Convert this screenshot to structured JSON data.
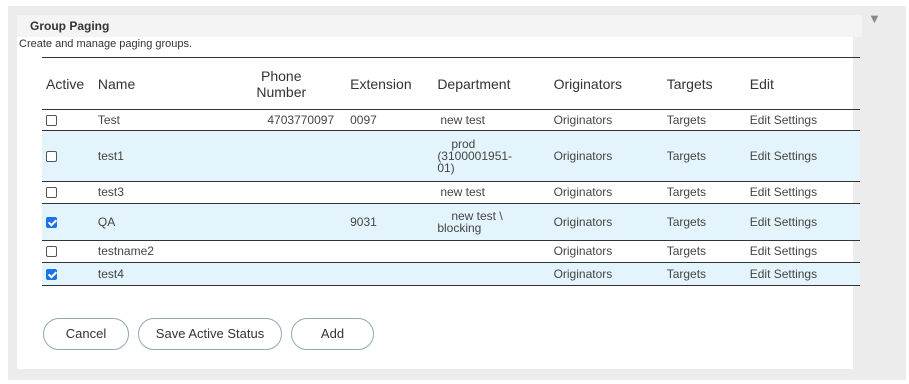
{
  "panel": {
    "title": "Group Paging",
    "subtitle": "Create and manage paging groups.",
    "collapse_glyph": "▼"
  },
  "table": {
    "headers": {
      "active": "Active",
      "name": "Name",
      "phone_line1": "Phone",
      "phone_line2": "Number",
      "extension": "Extension",
      "department": "Department",
      "originators": "Originators",
      "targets": "Targets",
      "edit": "Edit"
    },
    "rows": [
      {
        "active": false,
        "name": "Test",
        "phone": "4703770097",
        "extension": "0097",
        "department": "new test",
        "originators": "Originators",
        "targets": "Targets",
        "edit": "Edit Settings"
      },
      {
        "active": false,
        "name": "test1",
        "phone": "",
        "extension": "",
        "department_lines": [
          "prod",
          "(3100001951-",
          "01)"
        ],
        "originators": "Originators",
        "targets": "Targets",
        "edit": "Edit Settings"
      },
      {
        "active": false,
        "name": "test3",
        "phone": "",
        "extension": "",
        "department": "new test",
        "originators": "Originators",
        "targets": "Targets",
        "edit": "Edit Settings"
      },
      {
        "active": true,
        "name": "QA",
        "phone": "",
        "extension": "9031",
        "department_lines": [
          "new test \\",
          "blocking"
        ],
        "originators": "Originators",
        "targets": "Targets",
        "edit": "Edit Settings"
      },
      {
        "active": false,
        "name": "testname2",
        "phone": "",
        "extension": "",
        "department": "",
        "originators": "Originators",
        "targets": "Targets",
        "edit": "Edit Settings"
      },
      {
        "active": true,
        "name": "test4",
        "phone": "",
        "extension": "",
        "department": "",
        "originators": "Originators",
        "targets": "Targets",
        "edit": "Edit Settings"
      }
    ]
  },
  "buttons": {
    "cancel": "Cancel",
    "save": "Save Active Status",
    "add": "Add"
  }
}
